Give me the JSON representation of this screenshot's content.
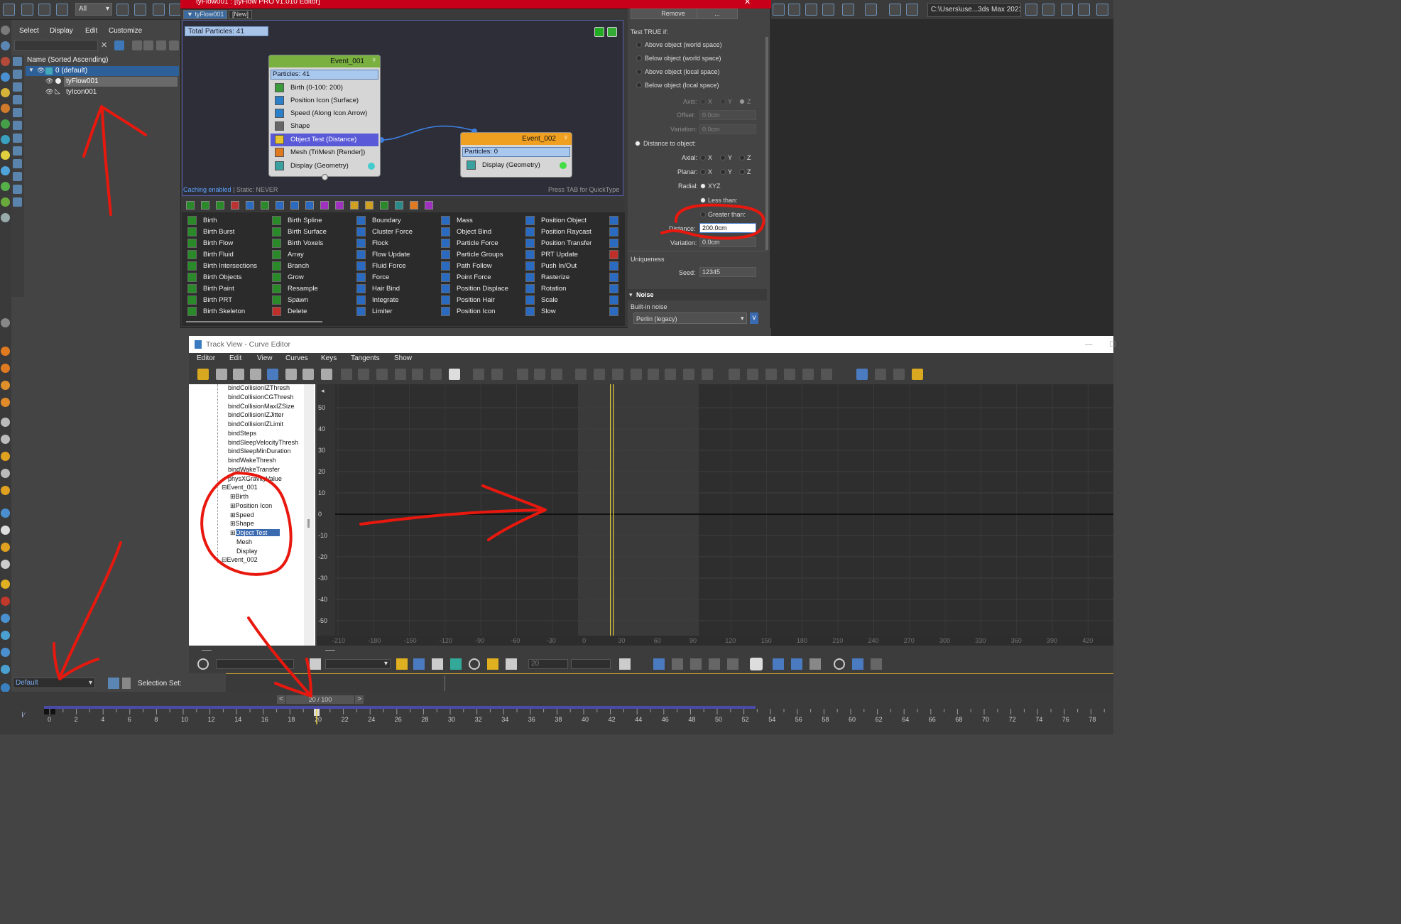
{
  "toolbar": {
    "selection_filter": "All",
    "project_path": "C:\\Users\\use...3ds Max 2021"
  },
  "scene_explorer": {
    "menu": [
      "Select",
      "Display",
      "Edit",
      "Customize"
    ],
    "column_header": "Name (Sorted Ascending)",
    "items": [
      {
        "label": "0 (default)",
        "selected": true
      },
      {
        "label": "tyFlow001",
        "selected": false,
        "highlight": true
      },
      {
        "label": "tyIcon001",
        "selected": false
      }
    ]
  },
  "tyflow_editor": {
    "title": "tyFlow001 : [tyFlow PRO v1.010 Editor]",
    "tabs": [
      "tyFlow001",
      "[New]"
    ],
    "total_particles": "Total Particles: 41",
    "cache_status": "Caching enabled",
    "static_status": "| Static: NEVER",
    "hint": "Press TAB for QuickType",
    "event1": {
      "title": "Event_001",
      "particles": "Particles: 41",
      "operators": [
        "Birth (0-100: 200)",
        "Position Icon (Surface)",
        "Speed (Along Icon Arrow)",
        "Shape",
        "Object Test (Distance)",
        "Mesh (TriMesh [Render])",
        "Display (Geometry)"
      ]
    },
    "event2": {
      "title": "Event_002",
      "particles": "Particles: 0",
      "operators": [
        "Display (Geometry)"
      ]
    },
    "operator_columns": [
      [
        "Birth",
        "Birth Burst",
        "Birth Flow",
        "Birth Fluid",
        "Birth Intersections",
        "Birth Objects",
        "Birth Paint",
        "Birth PRT",
        "Birth Skeleton"
      ],
      [
        "Birth Spline",
        "Birth Surface",
        "Birth Voxels",
        "Array",
        "Branch",
        "Grow",
        "Resample",
        "Spawn",
        "Delete"
      ],
      [
        "Boundary",
        "Cluster Force",
        "Flock",
        "Flow Update",
        "Fluid Force",
        "Force",
        "Hair Bind",
        "Integrate",
        "Limiter"
      ],
      [
        "Mass",
        "Object Bind",
        "Particle Force",
        "Particle Groups",
        "Path Follow",
        "Point Force",
        "Position Displace",
        "Position Hair",
        "Position Icon"
      ],
      [
        "Position Object",
        "Position Raycast",
        "Position Transfer",
        "PRT Update",
        "Push In/Out",
        "Rasterize",
        "Rotation",
        "Scale",
        "Slow"
      ]
    ]
  },
  "params": {
    "remove_label": "Remove",
    "more_label": "...",
    "test_true_if": "Test TRUE if:",
    "options": [
      "Above object (world space)",
      "Below object (world space)",
      "Above object (local space)",
      "Below object (local space)"
    ],
    "axis_label": "Axis:",
    "axis_x": "X",
    "axis_y": "Y",
    "axis_z": "Z",
    "offset_label": "Offset:",
    "offset_value": "0.0cm",
    "variation_label": "Variation:",
    "variation_value": "0.0cm",
    "distance_to_object": "Distance to object:",
    "axial_label": "Axial:",
    "planar_label": "Planar:",
    "radial_label": "Radial:",
    "radial_value": "XYZ",
    "less_than": "Less than:",
    "greater_than": "Greater than:",
    "distance_label": "Distance:",
    "distance_value": "200.0cm",
    "variation2_label": "Variation:",
    "variation2_value": "0.0cm",
    "uniqueness_header": "Uniqueness",
    "seed_label": "Seed:",
    "seed_value": "12345",
    "noise_header": "Noise",
    "builtin_noise": "Built-in noise",
    "noise_type": "Perlin (legacy)"
  },
  "curve_editor": {
    "title": "Track View - Curve Editor",
    "menu": [
      "Editor",
      "Edit",
      "View",
      "Curves",
      "Keys",
      "Tangents",
      "Show"
    ],
    "tree": [
      "bindCollisionIZThresh",
      "bindCollisionCGThresh",
      "bindCollisionMaxIZSize",
      "bindCollisionIZJitter",
      "bindCollisionIZLimit",
      "bindSteps",
      "bindSleepVelocityThresh",
      "bindSleepMinDuration",
      "bindWakeThresh",
      "bindWakeTransfer",
      "physXGravityValue",
      "Event_001",
      "Birth",
      "Position Icon",
      "Speed",
      "Shape",
      "Object Test",
      "Mesh",
      "Display",
      "Event_002"
    ],
    "y_ticks": [
      "50",
      "40",
      "30",
      "20",
      "10",
      "0",
      "-10",
      "-20",
      "-30",
      "-40",
      "-50"
    ],
    "x_ticks": [
      "-210",
      "-180",
      "-150",
      "-120",
      "-90",
      "-60",
      "-30",
      "0",
      "30",
      "60",
      "90",
      "120",
      "150",
      "180",
      "210",
      "240",
      "270",
      "300",
      "330",
      "360",
      "390",
      "420"
    ],
    "current_frame": "20"
  },
  "status": {
    "layer": "Default",
    "selection_set": "Selection Set:"
  },
  "timeline": {
    "frame_display": "20 / 100",
    "ticks": [
      "0",
      "2",
      "4",
      "6",
      "8",
      "10",
      "12",
      "14",
      "16",
      "18",
      "20",
      "22",
      "24",
      "26",
      "28",
      "30",
      "32",
      "34",
      "36",
      "38",
      "40",
      "42",
      "44",
      "46",
      "48",
      "50",
      "52",
      "54",
      "56",
      "58",
      "60",
      "62",
      "64",
      "66",
      "68",
      "70",
      "72",
      "74",
      "76",
      "78"
    ]
  }
}
